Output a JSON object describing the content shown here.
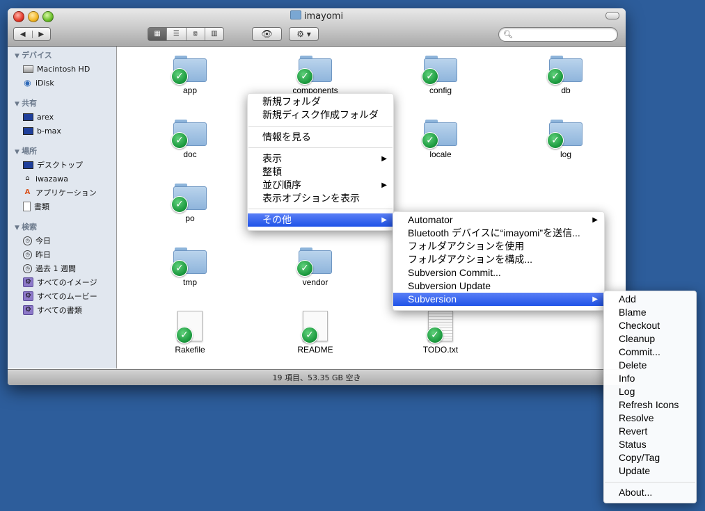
{
  "window": {
    "title": "imayomi",
    "status": "19 項目、53.35 GB 空き"
  },
  "toolbar": {
    "back_label": "◀",
    "forward_label": "▶",
    "views": [
      "▦",
      "☰",
      "⧈",
      "▥"
    ],
    "quicklook_label": "👁",
    "action_label": "⚙ ▾",
    "search_placeholder": ""
  },
  "sidebar": {
    "sections": [
      {
        "title": "デバイス",
        "items": [
          {
            "label": "Macintosh HD",
            "icon": "hard-drive-icon"
          },
          {
            "label": "iDisk",
            "icon": "idisk-icon"
          }
        ]
      },
      {
        "title": "共有",
        "items": [
          {
            "label": "arex",
            "icon": "monitor-icon"
          },
          {
            "label": "b-max",
            "icon": "monitor-icon"
          }
        ]
      },
      {
        "title": "場所",
        "items": [
          {
            "label": "デスクトップ",
            "icon": "desktop-icon"
          },
          {
            "label": "iwazawa",
            "icon": "home-icon"
          },
          {
            "label": "アプリケーション",
            "icon": "applications-icon"
          },
          {
            "label": "書類",
            "icon": "documents-icon"
          }
        ]
      },
      {
        "title": "検索",
        "items": [
          {
            "label": "今日",
            "icon": "clock-icon"
          },
          {
            "label": "昨日",
            "icon": "clock-icon"
          },
          {
            "label": "過去 1 週間",
            "icon": "clock-icon"
          },
          {
            "label": "すべてのイメージ",
            "icon": "smart-folder-icon"
          },
          {
            "label": "すべてのムービー",
            "icon": "smart-folder-icon"
          },
          {
            "label": "すべての書類",
            "icon": "smart-folder-icon"
          }
        ]
      }
    ]
  },
  "files": [
    {
      "name": "app",
      "kind": "folder"
    },
    {
      "name": "components",
      "kind": "folder"
    },
    {
      "name": "config",
      "kind": "folder"
    },
    {
      "name": "db",
      "kind": "folder"
    },
    {
      "name": "doc",
      "kind": "folder"
    },
    {
      "name": "locale",
      "kind": "folder"
    },
    {
      "name": "log",
      "kind": "folder"
    },
    {
      "name": "po",
      "kind": "folder"
    },
    {
      "name": "tmp",
      "kind": "folder"
    },
    {
      "name": "vendor",
      "kind": "folder"
    },
    {
      "name": "Rakefile",
      "kind": "file"
    },
    {
      "name": "README",
      "kind": "file"
    },
    {
      "name": "TODO.txt",
      "kind": "text-file"
    }
  ],
  "context_menu": {
    "items": [
      "新規フォルダ",
      "新規ディスク作成フォルダ",
      "情報を見る",
      "表示",
      "整頓",
      "並び順序",
      "表示オプションを表示",
      "その他"
    ]
  },
  "other_submenu": {
    "items": [
      "Automator",
      "Bluetooth デバイスに“imayomi”を送信...",
      "フォルダアクションを使用",
      "フォルダアクションを構成...",
      "Subversion Commit...",
      "Subversion Update",
      "Subversion"
    ]
  },
  "svn_submenu": {
    "items": [
      "Add",
      "Blame",
      "Checkout",
      "Cleanup",
      "Commit...",
      "Delete",
      "Info",
      "Log",
      "Refresh Icons",
      "Resolve",
      "Revert",
      "Status",
      "Copy/Tag",
      "Update",
      "About..."
    ]
  },
  "colors": {
    "desktop": "#2d5d9b",
    "highlight": "#1f53e8",
    "sidebar": "#e1e7ef",
    "checkmark": "#1c9a3f"
  }
}
